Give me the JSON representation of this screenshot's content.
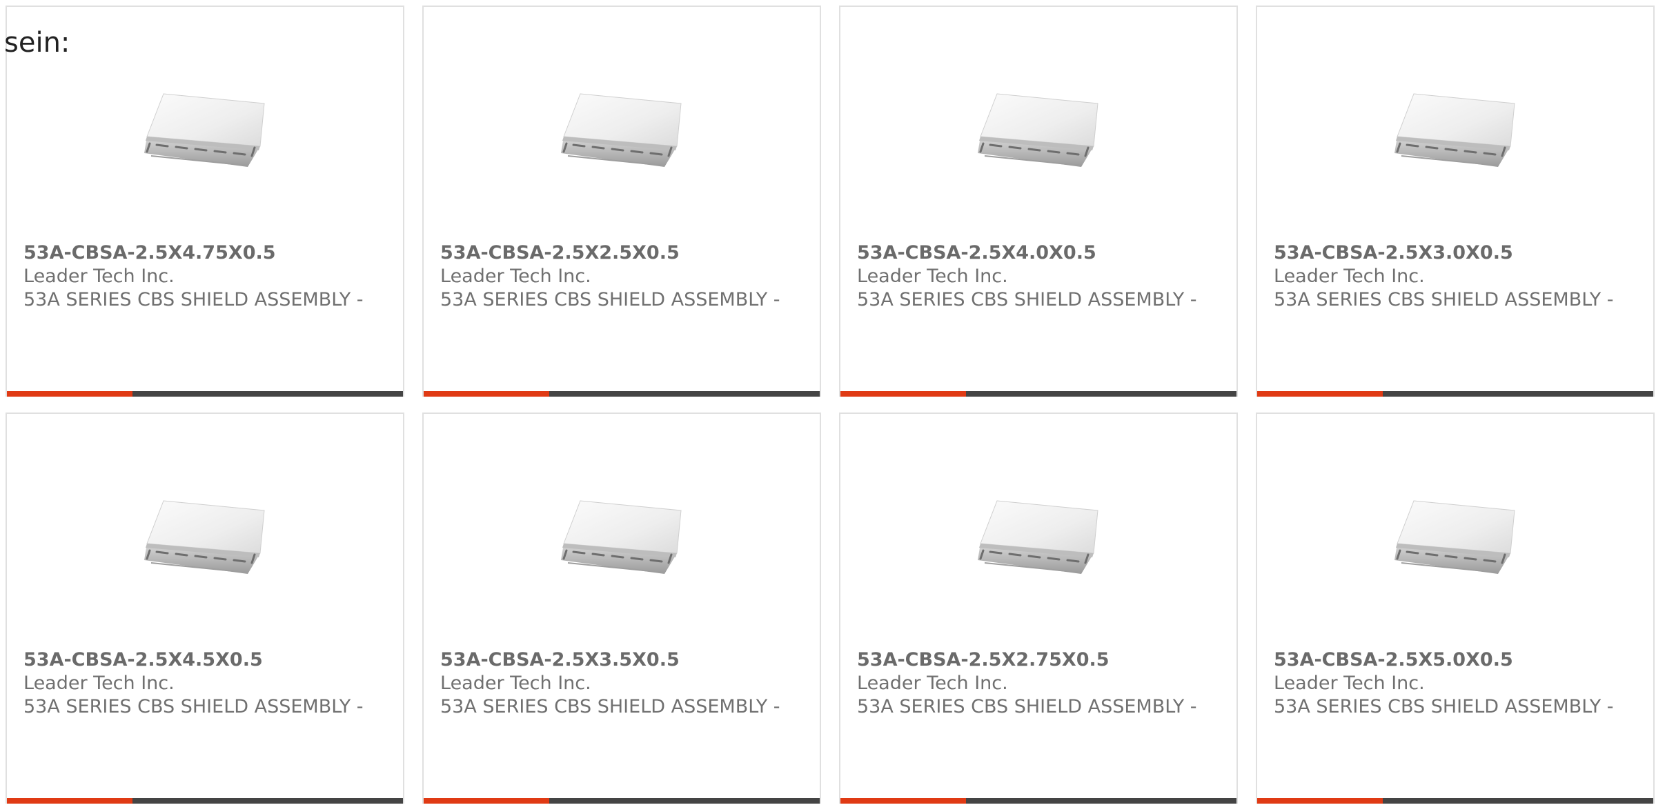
{
  "intro_text": "sein:",
  "accent_color": "#e03a14",
  "bar_color": "#444444",
  "products": [
    {
      "part_number": "53A-CBSA-2.5X4.75X0.5",
      "manufacturer": "Leader Tech Inc.",
      "description": "53A SERIES CBS SHIELD ASSEMBLY -",
      "image_icon": "shield-can-image"
    },
    {
      "part_number": "53A-CBSA-2.5X2.5X0.5",
      "manufacturer": "Leader Tech Inc.",
      "description": "53A SERIES CBS SHIELD ASSEMBLY -",
      "image_icon": "shield-can-image"
    },
    {
      "part_number": "53A-CBSA-2.5X4.0X0.5",
      "manufacturer": "Leader Tech Inc.",
      "description": "53A SERIES CBS SHIELD ASSEMBLY -",
      "image_icon": "shield-can-image"
    },
    {
      "part_number": "53A-CBSA-2.5X3.0X0.5",
      "manufacturer": "Leader Tech Inc.",
      "description": "53A SERIES CBS SHIELD ASSEMBLY -",
      "image_icon": "shield-can-image"
    },
    {
      "part_number": "53A-CBSA-2.5X4.5X0.5",
      "manufacturer": "Leader Tech Inc.",
      "description": "53A SERIES CBS SHIELD ASSEMBLY -",
      "image_icon": "shield-can-image"
    },
    {
      "part_number": "53A-CBSA-2.5X3.5X0.5",
      "manufacturer": "Leader Tech Inc.",
      "description": "53A SERIES CBS SHIELD ASSEMBLY -",
      "image_icon": "shield-can-image"
    },
    {
      "part_number": "53A-CBSA-2.5X2.75X0.5",
      "manufacturer": "Leader Tech Inc.",
      "description": "53A SERIES CBS SHIELD ASSEMBLY -",
      "image_icon": "shield-can-image"
    },
    {
      "part_number": "53A-CBSA-2.5X5.0X0.5",
      "manufacturer": "Leader Tech Inc.",
      "description": "53A SERIES CBS SHIELD ASSEMBLY -",
      "image_icon": "shield-can-image"
    }
  ]
}
